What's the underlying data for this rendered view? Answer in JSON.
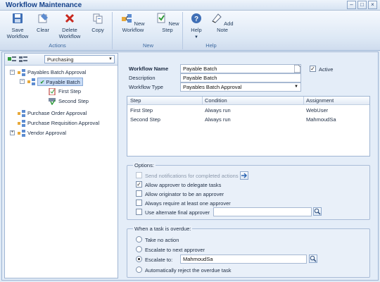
{
  "window": {
    "title": "Workflow Maintenance"
  },
  "ribbon": {
    "actions": {
      "label": "Actions",
      "save": "Save\nWorkflow",
      "clear": "Clear",
      "delete": "Delete\nWorkflow",
      "copy": "Copy"
    },
    "new": {
      "label": "New",
      "new_workflow": "New Workflow",
      "new_step": "New Step"
    },
    "help": {
      "label": "Help",
      "help": "Help",
      "add_note": "Add Note"
    }
  },
  "left": {
    "combo_value": "Purchasing",
    "tree": {
      "payables_batch_approval": "Payables Batch Approval",
      "payable_batch": "Payable Batch",
      "first_step": "First Step",
      "second_step": "Second Step",
      "purchase_order_approval": "Purchase Order Approval",
      "purchase_requisition_approval": "Purchase Requisition Approval",
      "vendor_approval": "Vendor Approval"
    }
  },
  "form": {
    "workflow_name_label": "Workflow Name",
    "workflow_name": "Payable Batch",
    "description_label": "Description",
    "description": "Payable Batch",
    "workflow_type_label": "Workflow Type",
    "workflow_type": "Payables Batch Approval",
    "active_label": "Active",
    "active": true
  },
  "grid": {
    "columns": [
      "Step",
      "Condition",
      "Assignment"
    ],
    "rows": [
      {
        "step": "First Step",
        "condition": "Always run",
        "assignment": "WebUser"
      },
      {
        "step": "Second Step",
        "condition": "Always run",
        "assignment": "MahmoudSa"
      }
    ]
  },
  "options": {
    "title": "Options:",
    "send_notifications": "Send notifications for completed actions",
    "allow_delegate": "Allow approver to delegate tasks",
    "allow_originator": "Allow originator to be an approver",
    "always_require": "Always require at least one approver",
    "use_alternate": "Use alternate final approver",
    "alternate_value": ""
  },
  "overdue": {
    "title": "When a task is overdue:",
    "take_no_action": "Take no action",
    "escalate_next": "Escalate to next approver",
    "escalate_to": "Escalate to:",
    "escalate_value": "MahmoudSa",
    "auto_reject": "Automatically reject the overdue task"
  },
  "colors": {
    "accent": "#15428b",
    "ribbon_bg": "#dde8f5",
    "selected": "#c9dcf6"
  }
}
